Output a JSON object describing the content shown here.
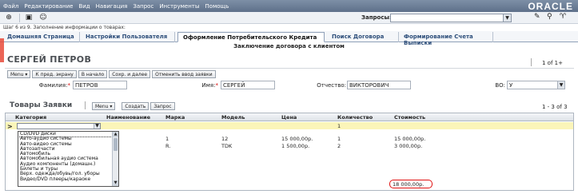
{
  "menubar": {
    "items": [
      "Файл",
      "Редактирование",
      "Вид",
      "Навигация",
      "Запрос",
      "Инструменты",
      "Помощь"
    ],
    "brand": "ORACLE"
  },
  "toolbar": {
    "queries_label": "Запросы:",
    "queries_value": ""
  },
  "step_info": "Шаг 6 из 9. Заполнение информации о товарах:",
  "tabs": [
    {
      "label": "Домашняя Страница",
      "active": false
    },
    {
      "label": "Настройки Пользователя",
      "active": false
    },
    {
      "label": "Оформление Потребительского Кредита",
      "active": true
    },
    {
      "label": "Поиск Договора",
      "active": false
    },
    {
      "label": "Формирование Счета Выписки",
      "active": false
    }
  ],
  "subtitle": "Заключение договора с клиентом",
  "page_name": "СЕРГЕЙ ПЕТРОВ",
  "record_count": "1 of 1+",
  "buttons": [
    "Menu ▾",
    "К пред. экрану",
    "В начало",
    "Сохр. и далее",
    "Отменить ввод заявки"
  ],
  "form": {
    "last_name_label": "Фамилия:",
    "last_name": "ПЕТРОВ",
    "first_name_label": "Имя:",
    "first_name": "СЕРГЕЙ",
    "middle_name_label": "Отчество:",
    "middle_name": "ВИКТОРОВИЧ",
    "vo_label": "ВО:",
    "vo_value": "У"
  },
  "goods": {
    "title": "Товары Заявки",
    "menu_label": "Menu ▾",
    "create_label": "Создать",
    "query_label": "Запрос",
    "count": "1 - 3 of 3",
    "columns": [
      "Категория",
      "Наименование",
      "Марка",
      "Модель",
      "Цена",
      "Количество",
      "Стоимость"
    ],
    "rows": [
      {
        "category": "",
        "name": "",
        "brand": "",
        "model": "",
        "price": "",
        "qty": "1",
        "cost": ""
      },
      {
        "category": "",
        "name": "",
        "brand": "1",
        "model": "12",
        "price": "15 000,00р.",
        "qty": "1",
        "cost": "15 000,00р."
      },
      {
        "category": "",
        "name": "",
        "brand": "R.",
        "model": "TDK",
        "price": "1 500,00р.",
        "qty": "2",
        "cost": "3 000,00р."
      }
    ],
    "dropdown": [
      "CD/DVD диски",
      "Авто-аудио системы",
      "Авто-видео системы",
      "Автозапчасти",
      "Автомобиль",
      "Автомобильная аудио система",
      "Аудио компоненты (домашн.)",
      "Билеты и туры",
      "Верх. одежда/обувь/гол. уборы",
      "Видео/DVD плееры/караоке"
    ],
    "total": "18 000,00р."
  }
}
